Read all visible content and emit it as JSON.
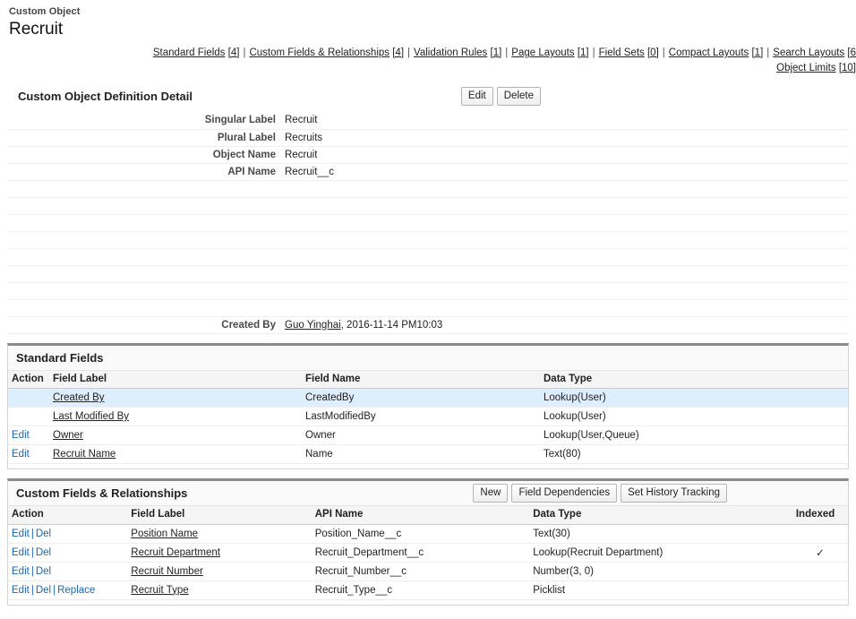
{
  "header": {
    "eyebrow": "Custom Object",
    "title": "Recruit"
  },
  "quicklinks": {
    "line1": [
      {
        "label": "Standard Fields",
        "count": "[4]"
      },
      {
        "label": "Custom Fields & Relationships",
        "count": "[4]"
      },
      {
        "label": "Validation Rules",
        "count": "[1]"
      },
      {
        "label": "Page Layouts",
        "count": "[1]"
      },
      {
        "label": "Field Sets",
        "count": "[0]"
      },
      {
        "label": "Compact Layouts",
        "count": "[1]"
      },
      {
        "label": "Search Layouts",
        "count": "[6"
      }
    ],
    "line2": [
      {
        "label": "Object Limits",
        "count": "[10]"
      }
    ],
    "separator": "|"
  },
  "detail": {
    "title": "Custom Object Definition Detail",
    "buttons": [
      {
        "label": "Edit",
        "name": "edit-button"
      },
      {
        "label": "Delete",
        "name": "delete-button"
      }
    ],
    "rows": [
      {
        "label": "Singular Label",
        "value": "Recruit"
      },
      {
        "label": "Plural Label",
        "value": "Recruits"
      },
      {
        "label": "Object Name",
        "value": "Recruit"
      },
      {
        "label": "API Name",
        "value": "Recruit__c"
      }
    ],
    "blank_row_count": 8,
    "created_by": {
      "label": "Created By",
      "user": "Guo Yinghai",
      "timestamp": ", 2016-11-14 PM10:03"
    }
  },
  "standard_fields": {
    "title": "Standard Fields",
    "columns": [
      "Action",
      "Field Label",
      "Field Name",
      "Data Type"
    ],
    "rows": [
      {
        "action": "",
        "field_label": "Created By",
        "field_name": "CreatedBy",
        "data_type": "Lookup(User)",
        "highlight": true
      },
      {
        "action": "",
        "field_label": "Last Modified By",
        "field_name": "LastModifiedBy",
        "data_type": "Lookup(User)",
        "highlight": false
      },
      {
        "action": "Edit",
        "field_label": "Owner",
        "field_name": "Owner",
        "data_type": "Lookup(User,Queue)",
        "highlight": false
      },
      {
        "action": "Edit",
        "field_label": "Recruit Name",
        "field_name": "Name",
        "data_type": "Text(80)",
        "highlight": false
      }
    ]
  },
  "custom_fields": {
    "title": "Custom Fields & Relationships",
    "buttons": [
      {
        "label": "New",
        "name": "new-button"
      },
      {
        "label": "Field Dependencies",
        "name": "field-dependencies-button"
      },
      {
        "label": "Set History Tracking",
        "name": "set-history-tracking-button"
      }
    ],
    "columns": [
      "Action",
      "Field Label",
      "API Name",
      "Data Type",
      "Indexed"
    ],
    "rows": [
      {
        "actions": [
          "Edit",
          "Del"
        ],
        "field_label": "Position Name",
        "api_name": "Position_Name__c",
        "data_type": "Text(30)",
        "indexed": ""
      },
      {
        "actions": [
          "Edit",
          "Del"
        ],
        "field_label": "Recruit Department",
        "api_name": "Recruit_Department__c",
        "data_type": "Lookup(Recruit Department)",
        "indexed": "✓"
      },
      {
        "actions": [
          "Edit",
          "Del"
        ],
        "field_label": "Recruit Number",
        "api_name": "Recruit_Number__c",
        "data_type": "Number(3, 0)",
        "indexed": ""
      },
      {
        "actions": [
          "Edit",
          "Del",
          "Replace"
        ],
        "field_label": "Recruit Type",
        "api_name": "Recruit_Type__c",
        "data_type": "Picklist",
        "indexed": ""
      }
    ],
    "action_separator": "|"
  },
  "colors": {
    "link": "#1a66b3",
    "highlight_row": "#ddeeff",
    "panel_top_border": "#8a8a8a"
  }
}
